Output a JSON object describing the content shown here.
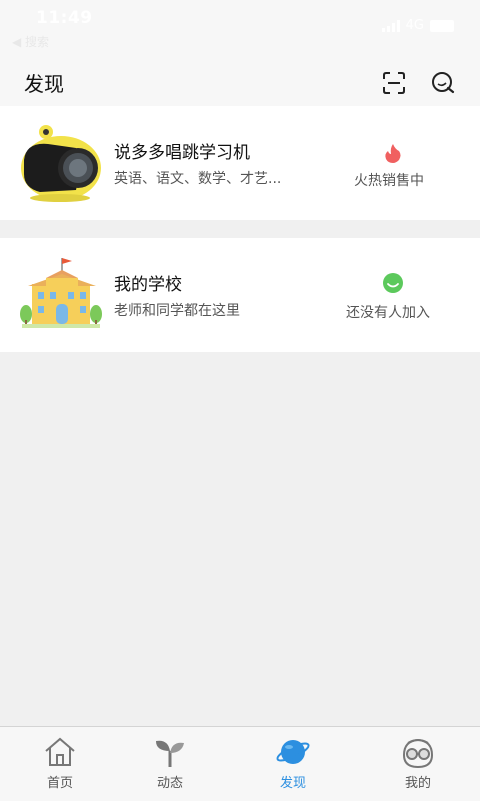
{
  "status_bar": {
    "time": "11:49",
    "back_label": "◀ 搜索",
    "network": "4G"
  },
  "header": {
    "title": "发现",
    "icons": [
      "scan-icon",
      "chat-search-icon"
    ]
  },
  "cards": [
    {
      "title": "说多多唱跳学习机",
      "subtitle": "英语、语文、数学、才艺...",
      "status_text": "火热销售中",
      "status_icon": "flame-icon",
      "status_color": "#f06060",
      "image": "robot-device-image"
    },
    {
      "title": "我的学校",
      "subtitle": "老师和同学都在这里",
      "status_text": "还没有人加入",
      "status_icon": "smiley-icon",
      "status_color": "#5cc95c",
      "image": "school-building-image"
    }
  ],
  "tabbar": {
    "tabs": [
      {
        "label": "首页",
        "icon": "house-icon",
        "active": false
      },
      {
        "label": "动态",
        "icon": "sprout-icon",
        "active": false
      },
      {
        "label": "发现",
        "icon": "planet-icon",
        "active": true
      },
      {
        "label": "我的",
        "icon": "glasses-face-icon",
        "active": false
      }
    ],
    "active_color": "#2c8fe0"
  }
}
